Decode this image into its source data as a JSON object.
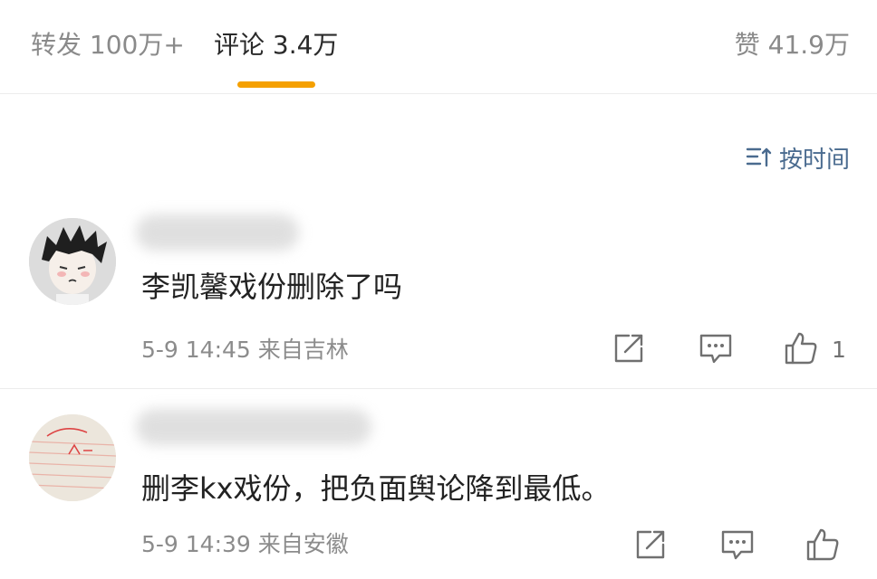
{
  "tabs": {
    "reposts": "转发 100万+",
    "comments": "评论 3.4万",
    "likes": "赞 41.9万",
    "active_color": "#f5a000"
  },
  "sort": {
    "label": "按时间",
    "icon": "sort-icon"
  },
  "comments": [
    {
      "text": "李凯馨戏份删除了吗",
      "meta": "5-9 14:45 来自吉林",
      "likes": "1",
      "actions": [
        "share-icon",
        "comment-icon",
        "thumbs-up-icon"
      ]
    },
    {
      "text": "删李kx戏份，把负面舆论降到最低。",
      "meta": "5-9 14:39 来自安徽",
      "actions": [
        "share-icon",
        "comment-icon",
        "thumbs-up-icon"
      ]
    }
  ],
  "colors": {
    "link": "#4a6b8f",
    "meta": "#8c8c8c"
  }
}
